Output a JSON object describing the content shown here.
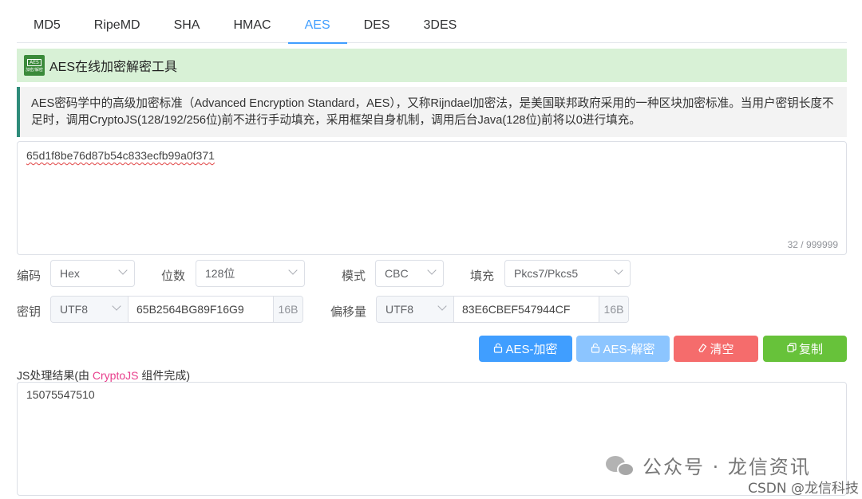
{
  "tabs": [
    "MD5",
    "RipeMD",
    "SHA",
    "HMAC",
    "AES",
    "DES",
    "3DES"
  ],
  "active_tab": "AES",
  "logo": {
    "line1": "AES",
    "line2": "加密/解密"
  },
  "title": "AES在线加密解密工具",
  "description": "AES密码学中的高级加密标准（Advanced Encryption Standard，AES），又称Rijndael加密法，是美国联邦政府采用的一种区块加密标准。当用户密钥长度不足时，调用CryptoJS(128/192/256位)前不进行手动填充，采用框架自身机制，调用后台Java(128位)前将以0进行填充。",
  "input": {
    "value": "65d1f8be76d87b54c833ecfb99a0f371",
    "counter": "32 / 999999"
  },
  "options": {
    "encoding_label": "编码",
    "encoding_value": "Hex",
    "bits_label": "位数",
    "bits_value": "128位",
    "mode_label": "模式",
    "mode_value": "CBC",
    "padding_label": "填充",
    "padding_value": "Pkcs7/Pkcs5"
  },
  "key": {
    "label": "密钥",
    "charset": "UTF8",
    "value": "65B2564BG89F16G9",
    "size": "16B"
  },
  "iv": {
    "label": "偏移量",
    "charset": "UTF8",
    "value": "83E6CBEF547944CF",
    "size": "16B"
  },
  "buttons": {
    "encrypt": "AES-加密",
    "decrypt": "AES-解密",
    "clear": "清空",
    "copy": "复制"
  },
  "result": {
    "label_prefix": "JS处理结果(由 ",
    "label_highlight": "CryptoJS",
    "label_suffix": " 组件完成)",
    "value": "15075547510"
  },
  "watermark": {
    "wechat": "公众号 · 龙信资讯",
    "csdn": "CSDN @龙信科技"
  },
  "colors": {
    "primary": "#409eff",
    "danger": "#f56c6c",
    "success": "#67c23a",
    "title_bg": "#d8f1d6",
    "desc_border": "#2e8b7a"
  }
}
